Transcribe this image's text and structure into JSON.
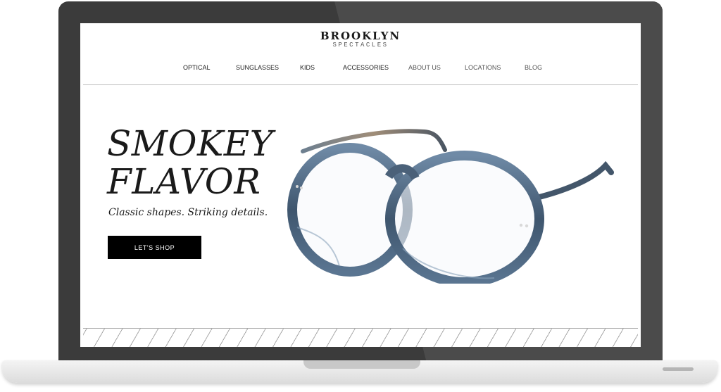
{
  "brand": {
    "name": "BROOKLYN",
    "subtitle": "SPECTACLES"
  },
  "nav": {
    "items": [
      {
        "label": "OPTICAL"
      },
      {
        "label": "SUNGLASSES"
      },
      {
        "label": "KIDS"
      },
      {
        "label": "ACCESSORIES"
      },
      {
        "label": "ABOUT US"
      },
      {
        "label": "LOCATIONS"
      },
      {
        "label": "BLOG"
      }
    ]
  },
  "hero": {
    "title_line1": "SMOKEY",
    "title_line2": "FLAVOR",
    "tagline": "Classic shapes. Striking details.",
    "cta_label": "LET'S SHOP",
    "image": "blue-tortoise-eyeglasses"
  },
  "colors": {
    "laptop_bezel": "#3b3b3b",
    "cta_background": "#000000",
    "frame_blue": "#4f6882"
  }
}
